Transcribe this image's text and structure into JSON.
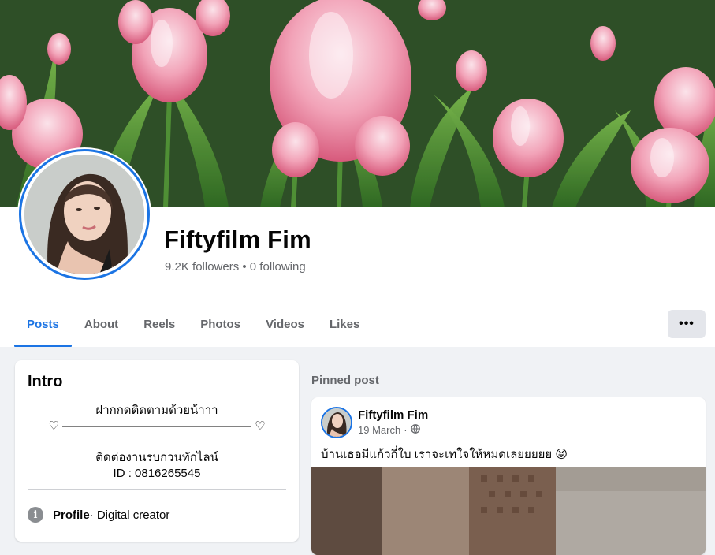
{
  "profile": {
    "name": "Fiftyfilm Fim",
    "stats": "9.2K followers • 0 following"
  },
  "tabs": [
    {
      "label": "Posts",
      "active": true
    },
    {
      "label": "About",
      "active": false
    },
    {
      "label": "Reels",
      "active": false
    },
    {
      "label": "Photos",
      "active": false
    },
    {
      "label": "Videos",
      "active": false
    },
    {
      "label": "Likes",
      "active": false
    }
  ],
  "more_button": {
    "label": "•••",
    "icon": "more-horizontal-icon"
  },
  "intro": {
    "title": "Intro",
    "bio_lines": [
      "ฝากกดติดตามด้วยน้าาา",
      "♡ ———————————————— ♡",
      "",
      "ติดต่องานรบกวนทักไลน์",
      "ID : 0816265545"
    ],
    "profile_row": {
      "icon": "info-icon",
      "label": "Profile",
      "value": " · Digital creator"
    }
  },
  "pinned": {
    "label": "Pinned post",
    "post": {
      "author": "Fiftyfilm Fim",
      "date": "19 March",
      "separator": "·",
      "privacy_icon": "globe-icon",
      "text": "บ้านเธอมีแก้วกี่ใบ เราจะเทใจให้หมดเลยยยยย 😝"
    }
  },
  "colors": {
    "accent": "#1b74e4",
    "background": "#f0f2f5",
    "secondary_text": "#65676b"
  }
}
